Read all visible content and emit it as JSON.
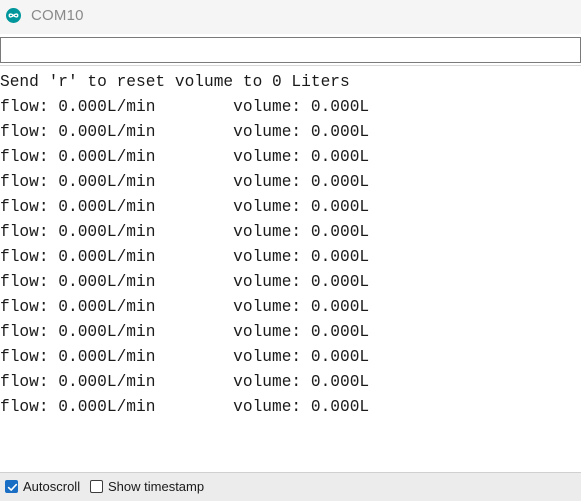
{
  "window": {
    "title": "COM10",
    "app_icon": "arduino-infinity-icon",
    "accent_color": "#00979c"
  },
  "input": {
    "value": "",
    "placeholder": ""
  },
  "output": {
    "lines": [
      "Send 'r' to reset volume to 0 Liters",
      "flow: 0.000L/min        volume: 0.000L",
      "flow: 0.000L/min        volume: 0.000L",
      "flow: 0.000L/min        volume: 0.000L",
      "flow: 0.000L/min        volume: 0.000L",
      "flow: 0.000L/min        volume: 0.000L",
      "flow: 0.000L/min        volume: 0.000L",
      "flow: 0.000L/min        volume: 0.000L",
      "flow: 0.000L/min        volume: 0.000L",
      "flow: 0.000L/min        volume: 0.000L",
      "flow: 0.000L/min        volume: 0.000L",
      "flow: 0.000L/min        volume: 0.000L",
      "flow: 0.000L/min        volume: 0.000L",
      "flow: 0.000L/min        volume: 0.000L"
    ]
  },
  "statusbar": {
    "autoscroll_label": "Autoscroll",
    "autoscroll_checked": true,
    "timestamp_label": "Show timestamp",
    "timestamp_checked": false,
    "checkbox_color": "#1a6fc4"
  }
}
